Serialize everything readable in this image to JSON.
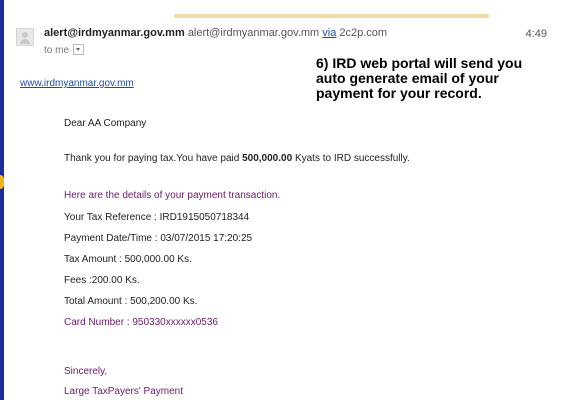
{
  "email": {
    "sender_name": "alert@irdmyanmar.gov.mm",
    "sender_address": "alert@irdmyanmar.gov.mm",
    "via_label": "via",
    "via_domain": "2c2p.com",
    "time": "4:49",
    "to_label": "to me"
  },
  "annotation": "6) IRD web portal will send you auto generate email of your payment for your record.",
  "site_link": "www.irdmyanmar.gov.mm",
  "body": {
    "greeting": "Dear AA Company",
    "thanks_prefix": "Thank you for paying tax.You have paid",
    "paid_amount": "500,000.00",
    "thanks_suffix": "Kyats to IRD successfully.",
    "details_heading": "Here are the details of your payment transaction.",
    "tax_reference": "Your Tax Reference : IRD1915050718344",
    "payment_datetime": "Payment Date/Time : 03/07/2015 17:20:25",
    "tax_amount": "Tax Amount : 500,000.00 Ks.",
    "fees": "Fees :200.00 Ks.",
    "total_amount": "Total Amount : 500,200.00 Ks.",
    "card_number": "Card Number : 950330xxxxxx0536",
    "closing": "Sincerely,",
    "signature": "Large TaxPayers' Payment"
  }
}
